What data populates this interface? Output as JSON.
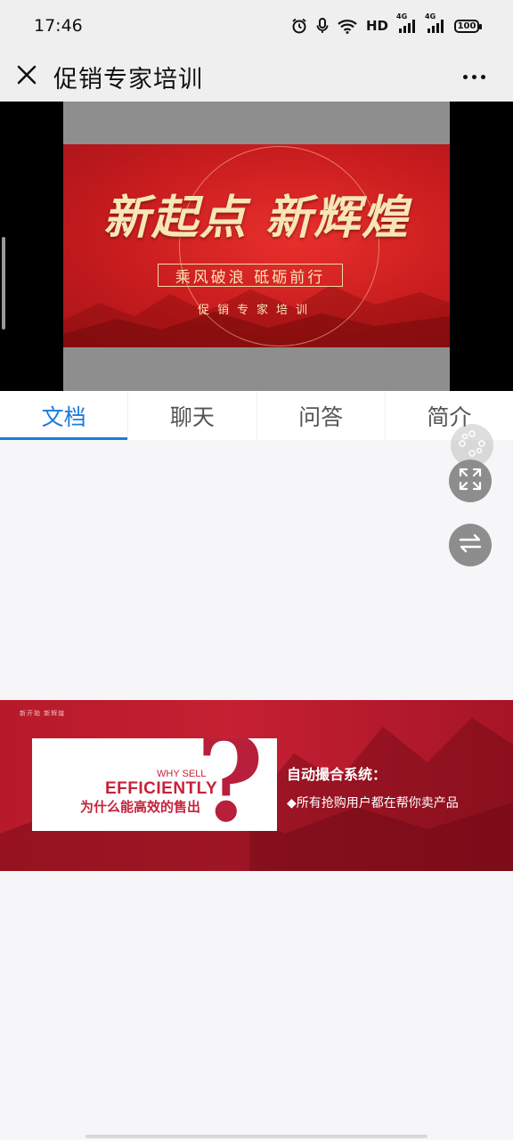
{
  "status_bar": {
    "time": "17:46",
    "network_hd": "HD",
    "signal_1": "4G",
    "signal_2": "4G",
    "battery": "100",
    "icons": [
      "alarm-icon",
      "mic-icon",
      "wifi-icon",
      "signal-icon",
      "signal-icon",
      "battery-icon"
    ]
  },
  "header": {
    "title": "促销专家培训",
    "close_icon": "close-icon",
    "more_icon": "more-icon"
  },
  "video": {
    "headline": "新起点 新辉煌",
    "subtitle": "乘风破浪 砥砺前行",
    "caption": "促销专家培训"
  },
  "tabs": [
    {
      "label": "文档",
      "active": true
    },
    {
      "label": "聊天",
      "active": false
    },
    {
      "label": "问答",
      "active": false
    },
    {
      "label": "简介",
      "active": false
    }
  ],
  "floating_buttons": {
    "top": "drag-handle-icon",
    "fullscreen": "expand-icon",
    "switch": "switch-icon"
  },
  "document_slide": {
    "tag": "新开始 新辉煌",
    "why": "WHY SELL",
    "efficiently": "EFFICIENTLY",
    "question_cn": "为什么能高效的售出",
    "question_mark": "?",
    "heading": "自动撮合系统：",
    "bullet": "◆所有抢购用户都在帮你卖产品"
  },
  "colors": {
    "accent": "#1a7ae0",
    "banner_red": "#c81c1e",
    "slide_red": "#b71a2a"
  }
}
